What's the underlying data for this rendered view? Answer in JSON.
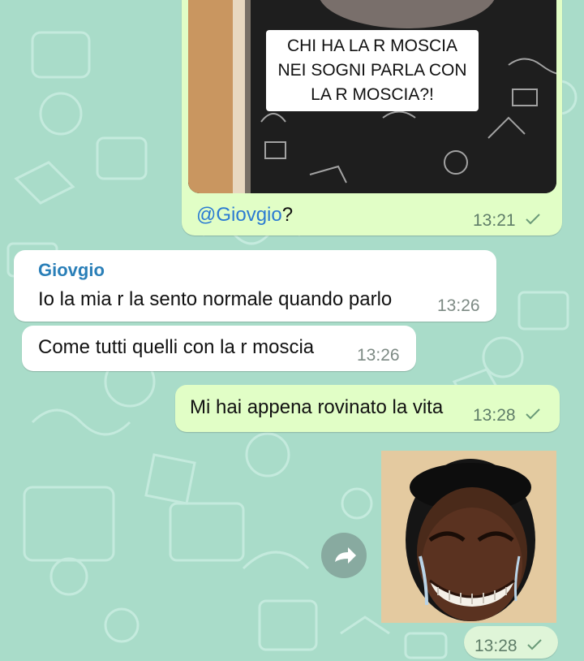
{
  "chat": {
    "video_message": {
      "caption_lines": [
        "CHI HA LA R MOSCIA",
        "NEI SOGNI PARLA CON",
        "LA R MOSCIA?!"
      ],
      "mention": "@Giovgio",
      "mention_suffix": "?",
      "time": "13:21",
      "status": "sent"
    },
    "reply_group": {
      "sender": "Giovgio",
      "sender_color": "#2a7fb8",
      "messages": [
        {
          "text": "Io la mia r la sento normale quando parlo",
          "time": "13:26"
        },
        {
          "text": "Come tutti quelli con la r moscia",
          "time": "13:26"
        }
      ]
    },
    "outgoing_text": {
      "text": "Mi hai appena rovinato la vita",
      "time": "13:28",
      "status": "sent"
    },
    "sticker_message": {
      "time": "13:28",
      "status": "sent",
      "forward_icon": "forward-arrow-icon"
    },
    "colors": {
      "wallpaper": "#a9dcc9",
      "outgoing_bubble": "#e1fec6",
      "incoming_bubble": "#ffffff",
      "mention": "#2b7bd2"
    }
  }
}
